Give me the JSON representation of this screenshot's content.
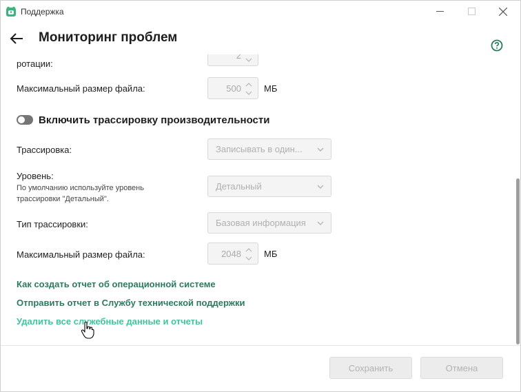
{
  "window": {
    "title": "Поддержка",
    "brand_color": "#3db37f"
  },
  "header": {
    "title": "Мониторинг проблем",
    "help_icon": "help-circle-icon",
    "back_icon": "back-arrow-icon"
  },
  "settings": {
    "rotation_label": "ротации:",
    "rotation_value": "2",
    "max_file_label_1": "Максимальный размер файла:",
    "max_file_value_1": "500",
    "unit_1": "МБ",
    "perf_toggle_label": "Включить трассировку производительности",
    "perf_toggle_on": false,
    "tracing_label": "Трассировка:",
    "tracing_value": "Записывать в один...",
    "level_label": "Уровень:",
    "level_hint": "По умолчанию используйте уровень трассировки \"Детальный\".",
    "level_value": "Детальный",
    "trace_type_label": "Тип трассировки:",
    "trace_type_value": "Базовая информация",
    "max_file_label_2": "Максимальный размер файла:",
    "max_file_value_2": "2048",
    "unit_2": "МБ"
  },
  "links": {
    "os_report": "Как создать отчет об операционной системе",
    "send_report": "Отправить отчет в Службу технической поддержки",
    "delete_data": "Удалить все служебные данные и отчеты"
  },
  "footer": {
    "save_label": "Сохранить",
    "cancel_label": "Отмена"
  },
  "colors": {
    "link": "#2b7a5f",
    "link_hover": "#3fc49b",
    "disabled_text": "#b0b0b0"
  }
}
